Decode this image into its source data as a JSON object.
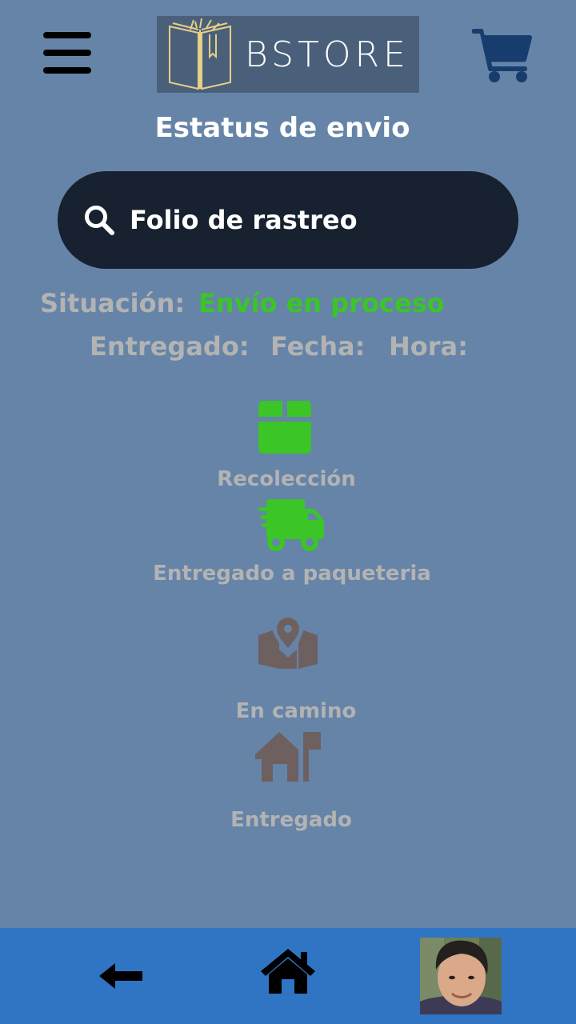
{
  "header": {
    "logo_text": "BSTORE"
  },
  "page": {
    "title": "Estatus de envio"
  },
  "search": {
    "placeholder": "Folio de rastreo"
  },
  "status": {
    "situacion_label": "Situación:",
    "situacion_value": "Envío en proceso",
    "entregado_label": "Entregado:",
    "fecha_label": "Fecha:",
    "hora_label": "Hora:"
  },
  "steps": [
    {
      "label": "Recolección",
      "icon": "box-icon",
      "state": "completed"
    },
    {
      "label": "Entregado a paqueteria",
      "icon": "truck-icon",
      "state": "completed"
    },
    {
      "label": "En camino",
      "icon": "map-pin-icon",
      "state": "pending"
    },
    {
      "label": "Entregado",
      "icon": "house-icon",
      "state": "pending"
    }
  ],
  "colors": {
    "background": "#6584a8",
    "search_bg": "#17212f",
    "completed": "#3bc526",
    "pending": "#6f6060",
    "nav_bar": "#2f75c4",
    "label": "#b3b3b3"
  },
  "bottom_nav": {
    "items": [
      "back-arrow-icon",
      "home-icon",
      "avatar"
    ]
  }
}
